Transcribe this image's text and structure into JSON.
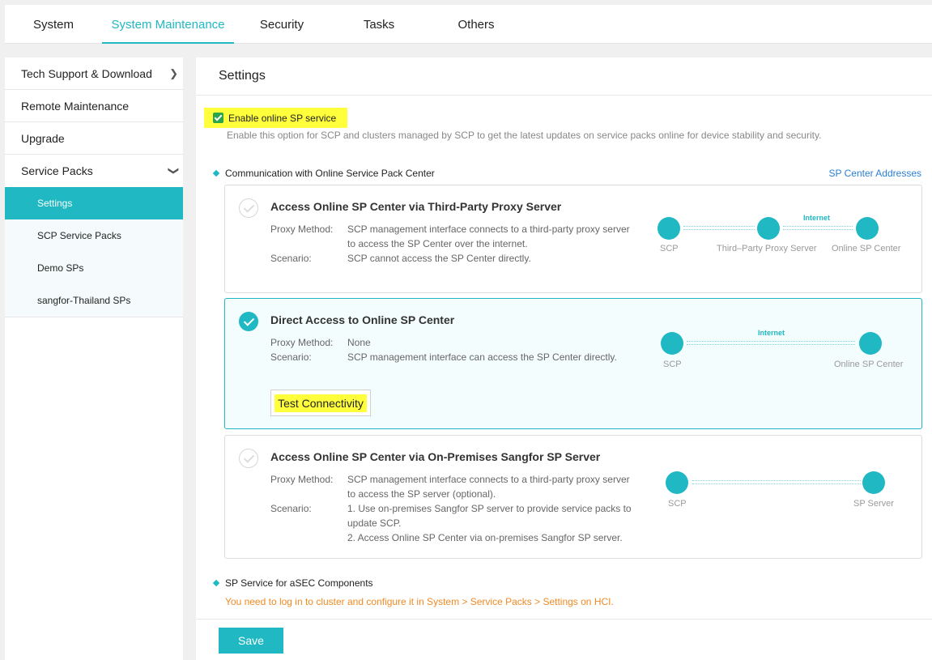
{
  "topnav": {
    "tabs": [
      "System",
      "System Maintenance",
      "Security",
      "Tasks",
      "Others"
    ],
    "active": "System Maintenance"
  },
  "sidebar": {
    "items": [
      {
        "label": "Tech Support & Download"
      },
      {
        "label": "Remote Maintenance"
      },
      {
        "label": "Upgrade"
      },
      {
        "label": "Service Packs"
      }
    ],
    "subitems": [
      "Settings",
      "SCP Service Packs",
      "Demo SPs",
      "sangfor-Thailand SPs"
    ],
    "active_sub": "Settings"
  },
  "main": {
    "title": "Settings",
    "enable_label": "Enable online SP service",
    "enable_checked": true,
    "enable_desc": "Enable this option for SCP and clusters managed by SCP to get the latest updates on service packs online for device stability and security.",
    "comm_section": "Communication with Online Service Pack Center",
    "sp_center_link": "SP Center Addresses",
    "cards": [
      {
        "title": "Access Online SP Center via Third-Party Proxy Server",
        "selected": false,
        "proxy_key": "Proxy Method:",
        "proxy_lines": [
          "SCP management interface connects to a third-party proxy server",
          "to access the SP Center over the internet."
        ],
        "scenario_key": "Scenario:",
        "scenario_lines": [
          "SCP cannot access the SP Center directly."
        ],
        "diagram": {
          "nodes": [
            "SCP",
            "Third–Party Proxy Server",
            "Online SP Center"
          ],
          "internet_label": "Internet"
        }
      },
      {
        "title": "Direct Access to Online SP Center",
        "selected": true,
        "proxy_key": "Proxy Method:",
        "proxy_lines": [
          "None"
        ],
        "scenario_key": "Scenario:",
        "scenario_lines": [
          "SCP management interface can access the SP Center directly."
        ],
        "test_button": "Test Connectivity",
        "diagram": {
          "nodes": [
            "SCP",
            "Online SP Center"
          ],
          "internet_label": "Internet"
        }
      },
      {
        "title": "Access Online SP Center via On-Premises Sangfor SP Server",
        "selected": false,
        "proxy_key": "Proxy Method:",
        "proxy_lines": [
          "SCP management interface connects to a third-party proxy server",
          "to access the SP server (optional)."
        ],
        "scenario_key": "Scenario:",
        "scenario_lines": [
          "1. Use on-premises Sangfor SP server to provide service packs to",
          "update SCP.",
          "2. Access Online SP Center via on-premises Sangfor SP server."
        ],
        "diagram": {
          "nodes": [
            "SCP",
            "SP Server"
          ]
        }
      }
    ],
    "asec_section": "SP Service for aSEC Components",
    "asec_note": "You need to log in to cluster and configure it in System > Service Packs > Settings on HCI.",
    "save_button": "Save"
  },
  "colors": {
    "accent": "#1fb8c3",
    "highlight": "#ffff3c",
    "warning": "#f08a24",
    "link": "#2b7fd4"
  }
}
